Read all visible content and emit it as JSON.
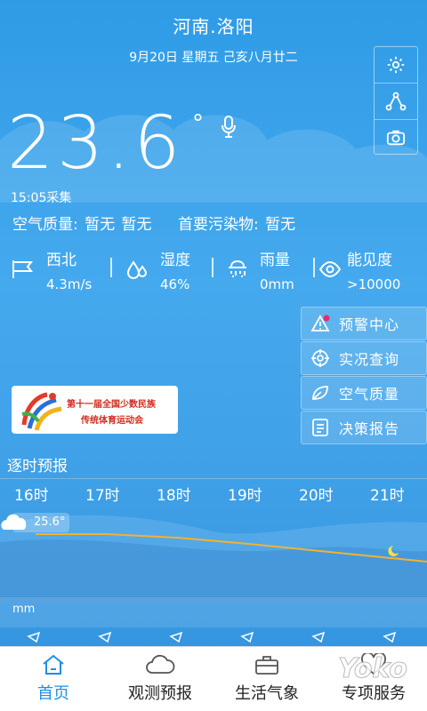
{
  "header": {
    "location": "河南.洛阳",
    "date": "9月20日  星期五  己亥八月廿二"
  },
  "side_tools": [
    "settings-icon",
    "share-icon",
    "camera-icon"
  ],
  "current": {
    "temp": "23.6",
    "deg": "°",
    "collect_time": "15:05采集"
  },
  "air": {
    "quality": "空气质量: 暂无 暂无",
    "pollutant": "首要污染物: 暂无"
  },
  "stats": [
    {
      "icon": "wind-flag-icon",
      "label": "西北",
      "value": "4.3m/s"
    },
    {
      "icon": "humidity-icon",
      "label": "湿度",
      "value": "46%"
    },
    {
      "icon": "rain-icon",
      "label": "雨量",
      "value": "0mm"
    },
    {
      "icon": "eye-icon",
      "label": "能见度",
      "value": ">10000"
    }
  ],
  "menu": [
    {
      "label": "预警中心",
      "icon": "warning-icon"
    },
    {
      "label": "实况查询",
      "icon": "target-icon"
    },
    {
      "label": "空气质量",
      "icon": "leaf-icon"
    },
    {
      "label": "决策报告",
      "icon": "report-icon"
    }
  ],
  "banner": {
    "line1": "第十一届全国少数民族",
    "line2": "传统体育运动会"
  },
  "hourly": {
    "title": "逐时预报",
    "hours": [
      "16时",
      "17时",
      "18时",
      "19时",
      "20时",
      "21时"
    ],
    "first_temp": "25.6°",
    "unit": "mm"
  },
  "tabs": [
    {
      "label": "首页",
      "icon": "home-icon",
      "active": true
    },
    {
      "label": "观测预报",
      "icon": "cloud-icon",
      "active": false
    },
    {
      "label": "生活气象",
      "icon": "briefcase-icon",
      "active": false
    },
    {
      "label": "专项服务",
      "icon": "heart-icon",
      "active": false
    }
  ],
  "watermark": "Yoko",
  "colors": {
    "accent": "#1e90e6",
    "temp_line": "#f3b22f",
    "sky": "#3e9fe6"
  }
}
